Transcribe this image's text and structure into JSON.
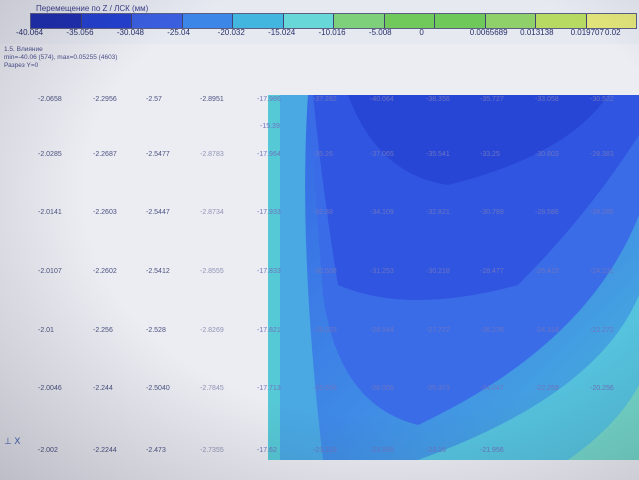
{
  "legend": {
    "title": "Перемещение по Z / ЛСК (мм)",
    "colors": [
      "#1f2fb0",
      "#2440cf",
      "#3a5fe0",
      "#3c86e8",
      "#43b6df",
      "#67d7d7",
      "#7fd07a",
      "#72c95b",
      "#6fc85a",
      "#8fd06b",
      "#b7da62",
      "#e2e57a"
    ],
    "ticks": [
      "-40.064",
      "-35.056",
      "-30.048",
      "-25.04",
      "-20.032",
      "-15.024",
      "-10.016",
      "-5.008",
      "0",
      "0.0065689",
      "0.013138",
      "0.019707",
      "0.02"
    ]
  },
  "info": {
    "line1": "1.5. Влияние",
    "line2": "min=-40.06 (574), max=0.05255 (4603)",
    "line3": "Разрез Y=0"
  },
  "grid": {
    "top_label": "-15.39",
    "rows": [
      [
        "-2.0658",
        "-2.2956",
        "-2.57",
        "-2.8951",
        "-17.986",
        "-37.282",
        "-40.064",
        "-38.356",
        "-35.727",
        "-33.058",
        "-30.522"
      ],
      [
        "-2.0285",
        "-2.2687",
        "-2.5477",
        "-2.8783",
        "-17.964",
        "-35.26",
        "-37.065",
        "-35.541",
        "-33.25",
        "-30.803",
        "-28.383"
      ],
      [
        "-2.0141",
        "-2.2603",
        "-2.5447",
        "-2.8734",
        "-17.933",
        "-32.88",
        "-34.109",
        "-32.821",
        "-30.789",
        "-28.586",
        "-26.285"
      ],
      [
        "-2.0107",
        "-2.2602",
        "-2.5412",
        "-2.8555",
        "-17.833",
        "-30.508",
        "-31.253",
        "-30.218",
        "-28.477",
        "-26.423",
        "-24.231"
      ],
      [
        "-2.01",
        "-2.256",
        "-2.528",
        "-2.8269",
        "-17.821",
        "-28.033",
        "-28.544",
        "-27.727",
        "-26.276",
        "-24.318",
        "-22.272"
      ],
      [
        "-2.0046",
        "-2.244",
        "-2.5040",
        "-2.7845",
        "-17.713",
        "-25.606",
        "-26.005",
        "-25.373",
        "-24.047",
        "-22.269",
        "-20.256"
      ],
      [
        "-2.002",
        "-2.2244",
        "-2.473",
        "-2.7355",
        "-17.62",
        "-23.223",
        "-23.555",
        "-23.16",
        "-21.956",
        "",
        ""
      ]
    ]
  },
  "axis": {
    "label": "⊥ X"
  }
}
